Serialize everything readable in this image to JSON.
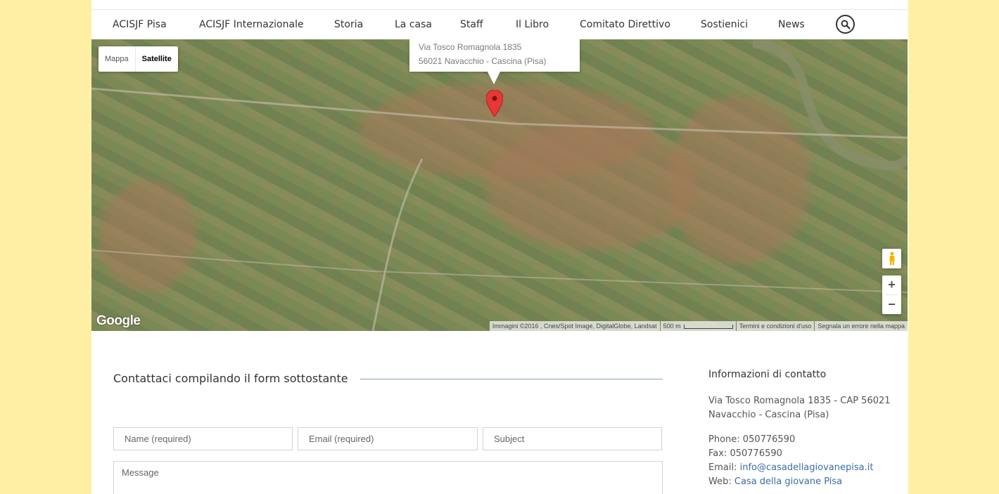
{
  "nav": {
    "items": [
      {
        "label": "ACISJF Pisa"
      },
      {
        "label": "ACISJF Internazionale"
      },
      {
        "label": "Storia"
      },
      {
        "label": "La casa"
      },
      {
        "label": "Staff"
      },
      {
        "label": "Il Libro"
      },
      {
        "label": "Comitato Direttivo"
      },
      {
        "label": "Sostienici"
      },
      {
        "label": "News"
      }
    ],
    "search_icon": "search-icon"
  },
  "map": {
    "type_controls": {
      "map_label": "Mappa",
      "satellite_label": "Satellite",
      "selected": "Satellite"
    },
    "info_window": {
      "line1": "Via Tosco Romagnola 1835",
      "line2": "56021 Navacchio - Cascina (Pisa)"
    },
    "logo": "Google",
    "attribution": {
      "imagery": "Immagini ©2016 , Cnes/Spot Image, DigitalGlobe, Landsat",
      "scale": "500 m",
      "terms": "Termini e condizioni d'uso",
      "report": "Segnala un errore nella mappa"
    },
    "zoom_in": "+",
    "zoom_out": "−"
  },
  "form": {
    "heading": "Contattaci compilando il form sottostante",
    "name_placeholder": "Name (required)",
    "email_placeholder": "Email (required)",
    "subject_placeholder": "Subject",
    "message_placeholder": "Message"
  },
  "contact_info": {
    "title": "Informazioni di contatto",
    "address_line1": "Via Tosco Romagnola 1835 - CAP 56021",
    "address_line2": "Navacchio - Cascina (Pisa)",
    "phone_label": "Phone:",
    "phone": "050776590",
    "fax_label": "Fax:",
    "fax": "050776590",
    "email_label": "Email:",
    "email": "info@casadellagiovanepisa.it",
    "web_label": "Web:",
    "web": "Casa della giovane Pisa"
  },
  "colors": {
    "background": "#fdf0a5",
    "link": "#3a6ea5",
    "pin": "#e53935"
  }
}
